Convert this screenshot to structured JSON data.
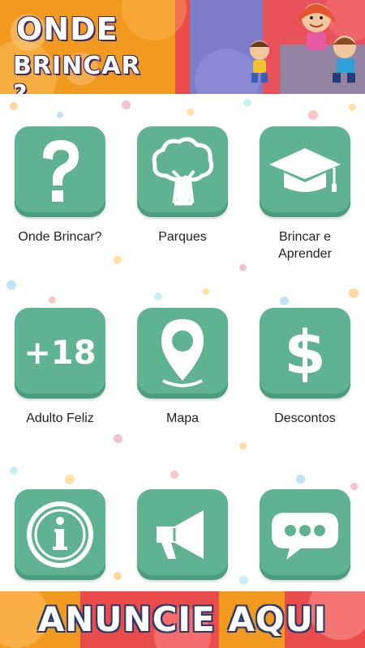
{
  "header": {
    "logo_line1": "ONDE",
    "logo_line2": "BRINCAR ?"
  },
  "menu": [
    {
      "label": "Onde Brincar?",
      "icon": "question-mark-icon"
    },
    {
      "label": "Parques",
      "icon": "tree-icon"
    },
    {
      "label": "Brincar e Aprender",
      "icon": "graduation-cap-icon"
    },
    {
      "label": "Adulto Feliz",
      "icon": "plus-18-icon",
      "icon_text": "+18"
    },
    {
      "label": "Mapa",
      "icon": "map-pin-icon"
    },
    {
      "label": "Descontos",
      "icon": "dollar-sign-icon",
      "icon_text": "$"
    },
    {
      "label": "",
      "icon": "info-icon"
    },
    {
      "label": "",
      "icon": "megaphone-icon"
    },
    {
      "label": "",
      "icon": "chat-bubble-icon"
    }
  ],
  "footer": {
    "banner_text": "ANUNCIE AQUI"
  },
  "colors": {
    "tile": "#5fb393",
    "header_orange": "#f29a1f",
    "header_red": "#ea4b4b",
    "header_purple": "#7c7cc8"
  }
}
